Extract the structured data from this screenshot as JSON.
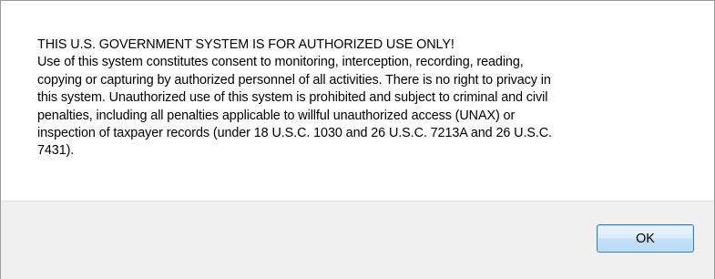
{
  "dialog": {
    "message": "THIS U.S. GOVERNMENT SYSTEM IS FOR AUTHORIZED USE ONLY!\nUse of this system constitutes consent to monitoring, interception, recording, reading,\ncopying or capturing by authorized personnel of all activities.  There is no right to privacy in\nthis system.  Unauthorized use of this system is prohibited and subject to criminal and civil\npenalties, including all penalties applicable to willful unauthorized access (UNAX) or\ninspection of taxpayer records (under 18 U.S.C. 1030 and 26 U.S.C. 7213A and 26 U.S.C.\n7431).",
    "ok_label": "OK"
  }
}
